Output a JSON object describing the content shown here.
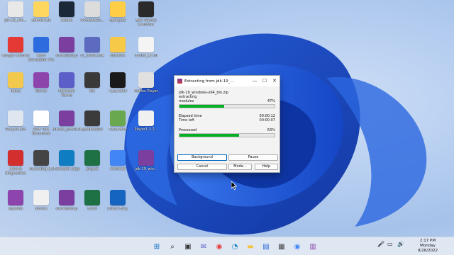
{
  "desktop": {
    "icons": [
      {
        "label": "jdk-19_win...",
        "color": "#e8e8e8"
      },
      {
        "label": "dotnetfx35",
        "color": "#ffd75e"
      },
      {
        "label": "Steam",
        "color": "#1b2838"
      },
      {
        "label": "windows10...",
        "color": "#dcdcdc"
      },
      {
        "label": "opengl32",
        "color": "#ffce45"
      },
      {
        "label": "Epic Games Launcher",
        "color": "#2a2a2a"
      },
      {
        "label": "Google Chrome",
        "color": "#e53935"
      },
      {
        "label": "Revo Uninstaller Pro",
        "color": "#2d6cdf"
      },
      {
        "label": "dxwebsetup",
        "color": "#7b3fa0"
      },
      {
        "label": "vc_redist.x64",
        "color": "#5c6bc0"
      },
      {
        "label": "dotnetfx",
        "color": "#f7c948"
      },
      {
        "label": "d3dx9_43.dll",
        "color": "#f4f4f4"
      },
      {
        "label": "Rufus",
        "color": "#f2c94c"
      },
      {
        "label": "Winrar",
        "color": "#8e44ad"
      },
      {
        "label": "Microsoft Teams",
        "color": "#5b5fc7"
      },
      {
        "label": "file",
        "color": "#3a3a3a"
      },
      {
        "label": "TLauncher",
        "color": "#1a1a1a"
      },
      {
        "label": "Roblox Player",
        "color": "#e0e0e0"
      },
      {
        "label": "Recycle Bin",
        "color": "#dfe6ef"
      },
      {
        "label": "New Text Document",
        "color": "#ffffff"
      },
      {
        "label": "directx_Jun2010...",
        "color": "#7b3fa0"
      },
      {
        "label": "EpicInstaller",
        "color": "#3b3b3b"
      },
      {
        "label": "TLauncher",
        "color": "#6aa84f"
      },
      {
        "label": "Player1.2.2...",
        "color": "#f0f0f0"
      },
      {
        "label": "Lenovo Diagnostics",
        "color": "#d32f2f"
      },
      {
        "label": "Recording (1)",
        "color": "#444444"
      },
      {
        "label": "Microsoft Edge",
        "color": "#0f7dc2"
      },
      {
        "label": "project",
        "color": "#1e7145"
      },
      {
        "label": "minidebt",
        "color": "#4285f4"
      },
      {
        "label": "jdk-19_win...",
        "color": "#7b3fa0"
      },
      {
        "label": "appdata",
        "color": "#8e44ad"
      },
      {
        "label": "directx",
        "color": "#f0f0f0"
      },
      {
        "label": "dxwebsetup",
        "color": "#7b3fa0"
      },
      {
        "label": "Excel",
        "color": "#1e7145"
      },
      {
        "label": "Driver Easy",
        "color": "#1565c0"
      }
    ]
  },
  "dialog": {
    "title": "Extracting from jdk-19_...",
    "minimize": "—",
    "maximize": "☐",
    "close": "✕",
    "archive_name": "jdk-19_windows-x64_bin.zip",
    "status": "extracting",
    "current_item": "modules",
    "item_percent_label": "47%",
    "item_progress": 47,
    "elapsed_label": "Elapsed time",
    "elapsed_value": "00:00:12",
    "time_left_label": "Time left",
    "time_left_value": "00:00:07",
    "processed_label": "Processed",
    "processed_percent_label": "63%",
    "processed_progress": 63,
    "buttons": {
      "background": "Background",
      "pause": "Pause",
      "cancel": "Cancel",
      "mode": "Mode...",
      "help": "Help"
    }
  },
  "taskbar": {
    "icons": [
      {
        "name": "windows-start-icon",
        "glyph": "⊞",
        "color": "#0067c0"
      },
      {
        "name": "search-icon",
        "glyph": "⌕",
        "color": "#222222"
      },
      {
        "name": "task-view-icon",
        "glyph": "▣",
        "color": "#333333"
      },
      {
        "name": "chat-icon",
        "glyph": "✉",
        "color": "#5b5fc7"
      },
      {
        "name": "chrome-icon",
        "glyph": "◉",
        "color": "#e53935"
      },
      {
        "name": "edge-icon",
        "glyph": "◔",
        "color": "#0f7dc2"
      },
      {
        "name": "file-explorer-icon",
        "glyph": "▬",
        "color": "#f5c542"
      },
      {
        "name": "store-icon",
        "glyph": "▤",
        "color": "#2d6cdf"
      },
      {
        "name": "news-icon",
        "glyph": "▦",
        "color": "#444444"
      },
      {
        "name": "chrome-icon-2",
        "glyph": "◉",
        "color": "#4285f4"
      },
      {
        "name": "winrar-icon",
        "glyph": "▥",
        "color": "#8e44ad"
      }
    ],
    "tray": {
      "mic": "🎤",
      "network": "▭",
      "volume": "🔊"
    },
    "time": "2:17 PM",
    "day": "Monday",
    "date": "9/26/2022"
  }
}
